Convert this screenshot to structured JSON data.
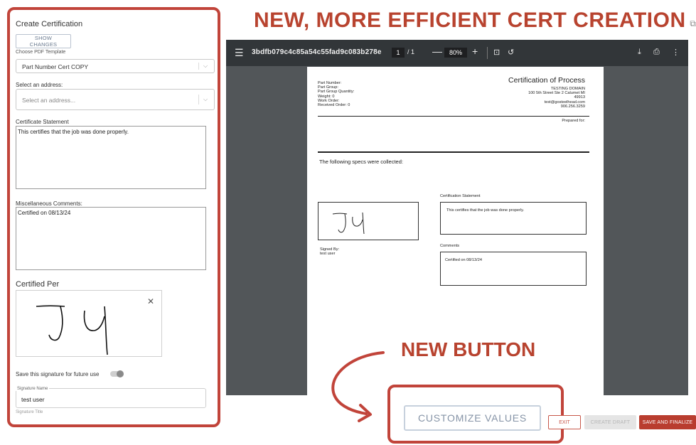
{
  "annotations": {
    "headline": "NEW, MORE EFFICIENT CERT CREATION",
    "new_button": "NEW BUTTON",
    "accent_color": "#b8432f"
  },
  "left_panel": {
    "title": "Create Certification",
    "show_changes_label": "SHOW CHANGES",
    "template_label": "Choose PDF Template",
    "template_value": "Part Number Cert COPY",
    "address_label": "Select an address:",
    "address_placeholder": "Select an address...",
    "statement_label": "Certificate Statement",
    "statement_value": "This certifies that the job was done properly.",
    "comments_label": "Miscellaneous Comments:",
    "comments_value": "Certified on 08/13/24",
    "certified_per_label": "Certified Per",
    "save_signature_label": "Save this signature for future use",
    "save_signature_on": false,
    "signature_name_label": "Signature Name",
    "signature_name_value": "test user",
    "signature_title_label": "Signature Title"
  },
  "pdf_viewer": {
    "filename": "3bdfb079c4c85a54c55fad9c083b278e",
    "page_current": "1",
    "page_total": "/  1",
    "zoom": "80%",
    "icons": [
      "menu-icon",
      "zoom-out-icon",
      "zoom-in-icon",
      "fit-page-icon",
      "rotate-icon",
      "download-icon",
      "print-icon",
      "more-icon"
    ]
  },
  "document": {
    "title": "Certification of Process",
    "left_meta": [
      "Part Number:",
      "Part Group:",
      "Part Group Quantity:",
      "Weight: 0",
      "Work Order:",
      "Received Order: 0"
    ],
    "right_meta": [
      "TESTING DOMAIN",
      "100 5th Street Ste 2 Calumet MI",
      "49913",
      "test@gosteelhead.com",
      "906.256.3259"
    ],
    "prepared_for": "Prepared for:",
    "specs_heading": "The following specs were collected:",
    "signed_by_label": "Signed By:",
    "signed_by_value": "test user",
    "cert_statement_label": "Certification Statement",
    "cert_statement_value": "This certifies that the job was done properly.",
    "comments_label": "Comments",
    "comments_value": "Certified on 08/13/24"
  },
  "actions": {
    "customize_label": "CUSTOMIZE VALUES",
    "exit_label": "EXIT",
    "draft_label": "CREATE DRAFT",
    "finalize_label": "SAVE AND FINALIZE"
  }
}
